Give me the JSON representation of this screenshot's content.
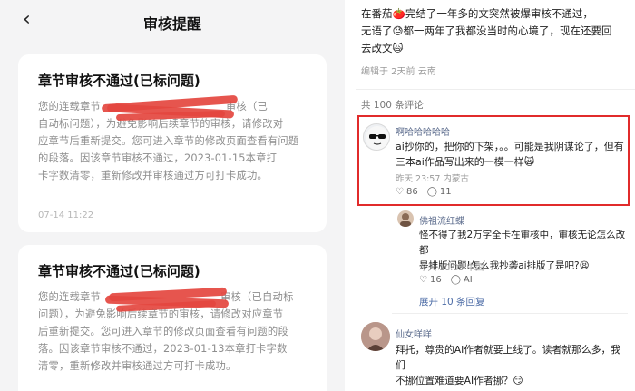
{
  "left": {
    "back_glyph": "‹",
    "title": "审核提醒",
    "card1": {
      "title": "章节审核不通过(已标问题)",
      "lines": [
        "您的连载章节",
        "自动标问题），为避免影响后续章节的审核，请修改对",
        "应章节后重新提交。您可进入章节的修改页面查看有问题",
        "的段落。因该章节审核不通过，2023-01-15本章打",
        "卡字数清零，重新修改并审核通过方可打卡成功。"
      ],
      "line1_tail": "审核（已",
      "time": "07-14 11:22"
    },
    "card2": {
      "title": "章节审核不通过(已标问题)",
      "lines": [
        "您的连载章节",
        "问题），为避免影响后续章节的审核，请修改对应章节",
        "后重新提交。您可进入章节的修改页面查看有问题的段",
        "落。因该章节审核不通过，2023-01-13本章打卡字数",
        "清零，重新修改并审核通过方可打卡成功。"
      ],
      "line1_tail": "审核（已自动标"
    }
  },
  "right": {
    "post_lines": [
      "在番茄🍅完结了一年多的文突然被爆审核不通过，",
      "无语了😓都一两年了我都没当时的心境了，现在还要回",
      "去改文🙀"
    ],
    "post_meta": "编辑于 2天前 云南",
    "comment_count": "共 100 条评论",
    "comments": [
      {
        "user": "啊哈哈哈哈哈",
        "text_lines": [
          "ai抄你的，把你的下架，。。可能是我阴谋论了，但有",
          "三本ai作品写出来的一模一样🙀"
        ],
        "meta": "昨天 23:57 内蒙古",
        "likes": "86",
        "replies": "11"
      },
      {
        "user": "佛祖流红蝶",
        "text_lines": [
          "怪不得了我2万字全卡在审核中，审核无论怎么改都",
          "是排版问题!怎么我抄袭ai排版了是吧?😫"
        ],
        "meta": "今天 10:05 中国",
        "likes": "16",
        "replies": "AI"
      },
      {
        "user": "仙女咩咩",
        "text_lines": [
          "拜托，尊贵的AI作者就要上线了。读者就那么多，我们",
          "不挪位置难道要AI作者挪？😏"
        ]
      }
    ],
    "expand": "展开 10 条回复",
    "colors": {
      "highlight": "#e12b2b",
      "redaction": "#e4463f",
      "link": "#4a6aa5"
    }
  }
}
